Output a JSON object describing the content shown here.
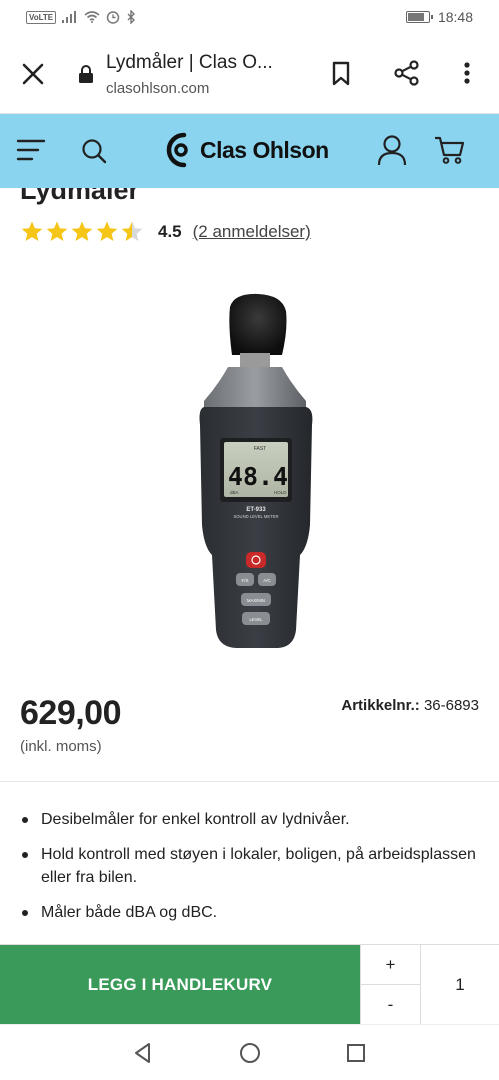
{
  "status_bar": {
    "volte": "VoLTE",
    "time": "18:48",
    "battery_level": 0.85
  },
  "browser": {
    "page_title": "Lydmåler | Clas O...",
    "url": "clasohlson.com"
  },
  "site": {
    "logo_text": "Clas Ohlson",
    "header_color": "#8bd4f0"
  },
  "product": {
    "title": "Lydmåler",
    "rating": 4.5,
    "rating_label": "4.5",
    "review_link": "(2 anmeldelser)",
    "display_value": "48.4",
    "display_fast": "FAST",
    "display_unit": "dBA",
    "display_hold": "HOLD",
    "model": "ET-933",
    "device_label": "SOUND LEVEL METER",
    "btn_fs": "F/S",
    "btn_ac": "A/C",
    "btn_maxmin": "MAX/MIN",
    "btn_level": "LEVEL",
    "price": "629,00",
    "price_note": "(inkl. moms)",
    "artnr_label": "Artikkelnr.:",
    "artnr_value": "36-6893",
    "features": [
      "Desibelmåler for enkel kontroll av lydnivåer.",
      "Hold kontroll med støyen i lokaler, boligen, på arbeidsplassen eller fra bilen.",
      "Måler både dBA og dBC."
    ]
  },
  "cart": {
    "add_label": "LEGG I HANDLEKURV",
    "plus": "+",
    "minus": "-",
    "quantity": "1",
    "accent": "#3a9a5a"
  },
  "icons": {
    "star_color": "#f5c518",
    "star_empty": "#d8d8d8"
  }
}
